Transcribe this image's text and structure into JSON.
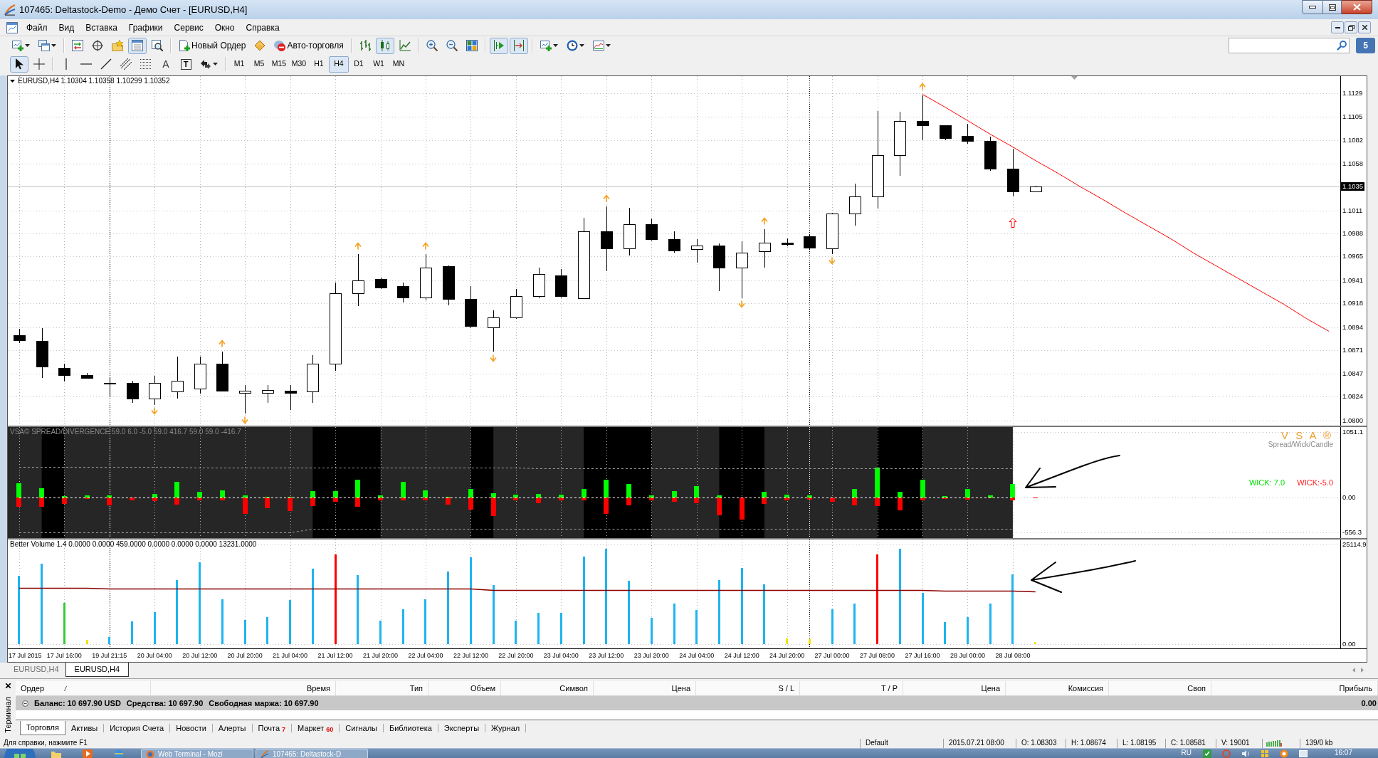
{
  "window": {
    "title": "107465: Deltastock-Demo - Демо Счет - [EURUSD,H4]"
  },
  "menu": {
    "items": [
      "Файл",
      "Вид",
      "Вставка",
      "Графики",
      "Сервис",
      "Окно",
      "Справка"
    ]
  },
  "toolbar_main": {
    "groups": [
      [
        {
          "kind": "dropdown",
          "pressed": false
        },
        {
          "kind": "dropdown",
          "pressed": false
        }
      ],
      [
        {
          "kind": "icon",
          "pressed": false
        },
        {
          "kind": "icon",
          "pressed": false
        },
        {
          "kind": "icon",
          "pressed": false
        },
        {
          "kind": "icon",
          "pressed": true
        },
        {
          "kind": "icon",
          "pressed": false
        }
      ],
      [
        {
          "kind": "labeled",
          "label": "Новый Ордер",
          "pressed": false
        },
        {
          "kind": "icon",
          "pressed": false
        },
        {
          "kind": "labeled",
          "label": "Авто-торговля",
          "pressed": false
        }
      ],
      [
        {
          "kind": "icon",
          "pressed": false
        },
        {
          "kind": "icon",
          "pressed": true
        },
        {
          "kind": "icon",
          "pressed": false
        }
      ],
      [
        {
          "kind": "icon",
          "pressed": false
        },
        {
          "kind": "icon",
          "pressed": false
        },
        {
          "kind": "icon",
          "pressed": false
        }
      ],
      [
        {
          "kind": "icon",
          "pressed": true
        },
        {
          "kind": "icon",
          "pressed": true
        }
      ],
      [
        {
          "kind": "dropdown",
          "pressed": false
        },
        {
          "kind": "dropdown",
          "pressed": false
        },
        {
          "kind": "dropdown",
          "pressed": false
        }
      ]
    ]
  },
  "search": {
    "badge": "5"
  },
  "toolbar_draw": {
    "groups": [
      [
        {
          "kind": "icon",
          "pressed": true
        },
        {
          "kind": "icon",
          "pressed": false
        }
      ],
      [
        {
          "kind": "icon",
          "pressed": false
        },
        {
          "kind": "icon",
          "pressed": false
        },
        {
          "kind": "icon",
          "pressed": false
        },
        {
          "kind": "icon",
          "pressed": false
        },
        {
          "kind": "icon",
          "pressed": false
        },
        {
          "kind": "glyph",
          "label": "A",
          "pressed": false
        },
        {
          "kind": "boxed-glyph",
          "label": "T",
          "pressed": false
        },
        {
          "kind": "dropdown",
          "pressed": false
        }
      ]
    ],
    "timeframes": [
      {
        "label": "M1",
        "selected": false
      },
      {
        "label": "M5",
        "selected": false
      },
      {
        "label": "M15",
        "selected": false
      },
      {
        "label": "M30",
        "selected": false
      },
      {
        "label": "H1",
        "selected": false
      },
      {
        "label": "H4",
        "selected": true
      },
      {
        "label": "D1",
        "selected": false
      },
      {
        "label": "W1",
        "selected": false
      },
      {
        "label": "MN",
        "selected": false
      }
    ]
  },
  "chart": {
    "chart_data": [
      {
        "type": "candlestick",
        "title": "EURUSD,H4 1.10304 1.10358 1.10299 1.10352",
        "categories": [
          null,
          null,
          null,
          null,
          null,
          null,
          null,
          null,
          null,
          null,
          null,
          null,
          null,
          null,
          null,
          null,
          null,
          null,
          null,
          null,
          null,
          null,
          null,
          null,
          null,
          null,
          null,
          null,
          null,
          null,
          null,
          null,
          null,
          null,
          null,
          null,
          null,
          null,
          null,
          null,
          null,
          null,
          null,
          null,
          null,
          null,
          null,
          null,
          null,
          null,
          null,
          null,
          null,
          null,
          null,
          null,
          null,
          null,
          null
        ],
        "ohlc": [
          [
            1.0886,
            1.0892,
            1.0878,
            1.0881
          ],
          [
            1.088,
            1.0893,
            1.0843,
            1.0854
          ],
          [
            1.0853,
            1.0857,
            1.0839,
            1.0846
          ],
          [
            1.0846,
            1.0848,
            1.0842,
            1.0843
          ],
          [
            1.0838,
            1.0843,
            1.0824,
            1.0837
          ],
          [
            1.0838,
            1.084,
            1.0818,
            1.0822
          ],
          [
            1.0822,
            1.0845,
            1.0816,
            1.0838
          ],
          [
            1.0829,
            1.0864,
            1.0822,
            1.084
          ],
          [
            1.0832,
            1.0864,
            1.0827,
            1.0857
          ],
          [
            1.0857,
            1.0869,
            1.0829,
            1.083
          ],
          [
            1.0828,
            1.0836,
            1.0807,
            1.083
          ],
          [
            1.0828,
            1.0836,
            1.0818,
            1.0831
          ],
          [
            1.083,
            1.0836,
            1.0811,
            1.0828
          ],
          [
            1.0829,
            1.0866,
            1.0818,
            1.0857
          ],
          [
            1.0857,
            1.0939,
            1.085,
            1.0928
          ],
          [
            1.0928,
            1.0967,
            1.0915,
            1.0941
          ],
          [
            1.0942,
            1.0944,
            1.0932,
            1.0934
          ],
          [
            1.0935,
            1.0939,
            1.0919,
            1.0924
          ],
          [
            1.0924,
            1.0967,
            1.0921,
            1.0954
          ],
          [
            1.0955,
            1.0956,
            1.0916,
            1.0922
          ],
          [
            1.0922,
            1.0935,
            1.0893,
            1.0895
          ],
          [
            1.0894,
            1.0911,
            1.0869,
            1.0904
          ],
          [
            1.0904,
            1.0932,
            1.0902,
            1.0925
          ],
          [
            1.0925,
            1.0954,
            1.0923,
            1.0947
          ],
          [
            1.0946,
            1.0952,
            1.0924,
            1.0925
          ],
          [
            1.0923,
            1.1004,
            1.0922,
            1.099
          ],
          [
            1.099,
            1.1015,
            1.095,
            1.0973
          ],
          [
            1.0973,
            1.1014,
            1.0966,
            1.0997
          ],
          [
            1.0997,
            1.1003,
            1.0981,
            1.0982
          ],
          [
            1.0982,
            1.099,
            1.0969,
            1.0971
          ],
          [
            1.0972,
            1.0982,
            1.0959,
            1.0976
          ],
          [
            1.0976,
            1.0978,
            1.093,
            1.0954
          ],
          [
            1.0954,
            1.098,
            1.0923,
            1.0969
          ],
          [
            1.097,
            1.0992,
            1.0954,
            1.0979
          ],
          [
            1.0979,
            1.0983,
            1.0975,
            1.0977
          ],
          [
            1.0985,
            1.0987,
            1.0972,
            1.0974
          ],
          [
            1.0973,
            1.1009,
            1.0967,
            1.1008
          ],
          [
            1.1008,
            1.1038,
            1.0996,
            1.1025
          ],
          [
            1.1025,
            1.1111,
            1.1013,
            1.1067
          ],
          [
            1.1067,
            1.111,
            1.1046,
            1.1101
          ],
          [
            1.1101,
            1.1127,
            1.1082,
            1.1097
          ],
          [
            1.1097,
            1.1097,
            1.1082,
            1.1084
          ],
          [
            1.1086,
            1.1098,
            1.1078,
            1.1081
          ],
          [
            1.1081,
            1.1085,
            1.1051,
            1.1053
          ],
          [
            1.1053,
            1.1073,
            1.1025,
            1.103
          ],
          [
            1.10304,
            1.10358,
            1.10299,
            1.10352
          ],
          null,
          null,
          null,
          null,
          null,
          null,
          null,
          null,
          null,
          null,
          null,
          null,
          null
        ],
        "series": [
          {
            "type": "scatter",
            "color": "#f7a01c",
            "values": [
              null,
              null,
              null,
              null,
              null,
              null,
              null,
              null,
              null,
              1.0877,
              null,
              null,
              null,
              null,
              null,
              1.0975,
              null,
              null,
              1.0975,
              null,
              null,
              null,
              null,
              null,
              null,
              null,
              1.1023,
              null,
              null,
              null,
              null,
              null,
              null,
              1.1,
              null,
              null,
              null,
              null,
              null,
              null,
              1.1135,
              null,
              null,
              null,
              null,
              null,
              null,
              null,
              null,
              null,
              null,
              null,
              null,
              null,
              null,
              null,
              null,
              null,
              null
            ]
          },
          {
            "type": "scatter",
            "color": "#f7a01c",
            "values": [
              null,
              null,
              null,
              null,
              null,
              null,
              1.081,
              null,
              null,
              null,
              1.0801,
              null,
              null,
              null,
              null,
              null,
              null,
              null,
              null,
              null,
              null,
              1.0863,
              null,
              null,
              null,
              null,
              null,
              null,
              null,
              null,
              null,
              null,
              1.0917,
              null,
              null,
              null,
              1.0961,
              null,
              null,
              null,
              null,
              null,
              null,
              null,
              null,
              null,
              null,
              null,
              null,
              null,
              null,
              null,
              null,
              null,
              null,
              null,
              null,
              null,
              null
            ]
          },
          {
            "type": "scatter",
            "color": "#ff0000",
            "values": [
              null,
              null,
              null,
              null,
              null,
              null,
              null,
              null,
              null,
              null,
              null,
              null,
              null,
              null,
              null,
              null,
              null,
              null,
              null,
              null,
              null,
              null,
              null,
              null,
              null,
              null,
              null,
              null,
              null,
              null,
              null,
              null,
              null,
              null,
              null,
              null,
              null,
              null,
              null,
              null,
              null,
              null,
              null,
              null,
              1.0999,
              null,
              null,
              null,
              null,
              null,
              null,
              null,
              null,
              null,
              null,
              null,
              null,
              null,
              null
            ]
          },
          {
            "type": "line",
            "color": "#ff0000",
            "values": [
              null,
              null,
              null,
              null,
              null,
              null,
              null,
              null,
              null,
              null,
              null,
              null,
              null,
              null,
              null,
              null,
              null,
              null,
              null,
              null,
              null,
              null,
              null,
              null,
              null,
              null,
              null,
              null,
              null,
              null,
              null,
              null,
              null,
              null,
              null,
              null,
              null,
              null,
              null,
              null,
              1.1128,
              1.1115,
              1.1102,
              1.1088,
              1.1075,
              1.1062,
              1.1049,
              1.1035,
              1.1022,
              1.1009,
              1.0996,
              1.0983,
              1.0969,
              1.0956,
              1.0943,
              1.093,
              1.0917,
              1.0903,
              1.089
            ]
          }
        ],
        "ylim": [
          1.0795,
          1.1146
        ],
        "yticks": [
          {
            "value": 1.1129,
            "label": "1.1129"
          },
          {
            "value": 1.1105,
            "label": "1.1105"
          },
          {
            "value": 1.1082,
            "label": "1.1082"
          },
          {
            "value": 1.1058,
            "label": "1.1058"
          },
          {
            "value": 1.1011,
            "label": "1.1011"
          },
          {
            "value": 1.0988,
            "label": "1.0988"
          },
          {
            "value": 1.0965,
            "label": "1.0965"
          },
          {
            "value": 1.0941,
            "label": "1.0941"
          },
          {
            "value": 1.0918,
            "label": "1.0918"
          },
          {
            "value": 1.0894,
            "label": "1.0894"
          },
          {
            "value": 1.0871,
            "label": "1.0871"
          },
          {
            "value": 1.0847,
            "label": "1.0847"
          },
          {
            "value": 1.0824,
            "label": "1.0824"
          },
          {
            "value": 1.08,
            "label": "1.0800"
          }
        ],
        "tick_labels": "y",
        "grid": true,
        "ref_lines": [
          {
            "axis": "y",
            "value": 1.10352,
            "label": "1.1035",
            "color": "#c0c0c0"
          }
        ]
      },
      {
        "type": "bar",
        "title": "VSA© SPREAD/DIVERGENCE 59.0 6.0 -5.0 59.0 416.7 59.0 59.0 -416.7",
        "categories": [
          null,
          null,
          null,
          null,
          null,
          null,
          null,
          null,
          null,
          null,
          null,
          null,
          null,
          null,
          null,
          null,
          null,
          null,
          null,
          null,
          null,
          null,
          null,
          null,
          null,
          null,
          null,
          null,
          null,
          null,
          null,
          null,
          null,
          null,
          null,
          null,
          null,
          null,
          null,
          null,
          null,
          null,
          null,
          null,
          null,
          null,
          null,
          null,
          null,
          null,
          null,
          null,
          null,
          null,
          null,
          null,
          null,
          null,
          null
        ],
        "stacked": true,
        "series": [
          {
            "color": "#00ff00",
            "values": [
              230,
              150,
              20,
              30,
              40,
              null,
              60,
              250,
              90,
              120,
              40,
              10,
              10,
              100,
              100,
              290,
              30,
              250,
              110,
              10,
              140,
              70,
              50,
              60,
              50,
              140,
              280,
              220,
              30,
              100,
              180,
              30,
              null,
              90,
              50,
              30,
              null,
              140,
              480,
              90,
              280,
              20,
              140,
              30,
              220,
              null,
              null,
              null,
              null,
              null,
              null,
              null,
              null,
              null,
              null,
              null,
              null,
              null,
              null
            ]
          },
          {
            "color": "#ff0000",
            "values": [
              -150,
              -150,
              -100,
              -20,
              -120,
              -50,
              -60,
              -110,
              -50,
              -40,
              -260,
              -170,
              -220,
              -140,
              -70,
              -150,
              -50,
              -40,
              -50,
              -110,
              -190,
              -300,
              -40,
              -90,
              -50,
              -40,
              -260,
              -120,
              -40,
              -70,
              -90,
              -280,
              -350,
              -100,
              -50,
              -30,
              -70,
              -120,
              -140,
              -210,
              -50,
              -20,
              -30,
              -10,
              -40,
              -10,
              null,
              null,
              null,
              null,
              null,
              null,
              null,
              null,
              null,
              null,
              null,
              null,
              null
            ]
          },
          {
            "type": "line",
            "color": "#a0a0a0",
            "line_style": "dashed",
            "values": [
              490,
              490,
              490,
              490,
              490,
              490,
              490,
              490,
              480,
              480,
              480,
              480,
              480,
              480,
              480,
              480,
              480,
              480,
              480,
              480,
              480,
              480,
              480,
              470,
              470,
              470,
              470,
              470,
              470,
              470,
              470,
              470,
              470,
              470,
              470,
              470,
              470,
              470,
              470,
              470,
              470,
              470,
              470,
              470,
              470,
              null,
              null,
              null,
              null,
              null,
              null,
              null,
              null,
              null,
              null,
              null,
              null,
              null,
              null
            ]
          },
          {
            "type": "line",
            "color": "#a0a0a0",
            "line_style": "dashed",
            "values": [
              -560,
              -560,
              -560,
              -560,
              -560,
              -560,
              -560,
              -560,
              -560,
              -560,
              -560,
              -560,
              -560,
              -500,
              -500,
              -500,
              -500,
              -500,
              -500,
              -500,
              -500,
              -500,
              -500,
              -500,
              -500,
              -500,
              -500,
              -500,
              -500,
              -500,
              -500,
              -500,
              -500,
              -500,
              -500,
              -500,
              -500,
              -500,
              -500,
              -500,
              -500,
              -500,
              -500,
              -500,
              -500,
              null,
              null,
              null,
              null,
              null,
              null,
              null,
              null,
              null,
              null,
              null,
              null,
              null,
              null
            ]
          },
          {
            "type": "line",
            "color": "#ffffff",
            "line_style": "dashed",
            "values": [
              0,
              0,
              0,
              0,
              0,
              0,
              0,
              0,
              0,
              0,
              0,
              0,
              0,
              0,
              0,
              0,
              0,
              0,
              0,
              0,
              0,
              0,
              0,
              0,
              0,
              0,
              0,
              0,
              0,
              0,
              0,
              0,
              0,
              0,
              0,
              0,
              0,
              0,
              0,
              0,
              0,
              0,
              0,
              0,
              0,
              null,
              null,
              null,
              null,
              null,
              null,
              null,
              null,
              null,
              null,
              null,
              null,
              null,
              null
            ]
          }
        ],
        "ylim": [
          -650,
          1130
        ],
        "yticks": [
          {
            "value": 1051.1,
            "label": "1051.1"
          },
          {
            "value": 0,
            "label": "0.00"
          },
          {
            "value": -556.3,
            "label": "-556.3"
          }
        ],
        "tick_labels": "y",
        "grid": true,
        "annotations": [
          "V S A ®",
          "Spread/Wick/Candle",
          "WICK: 7.0",
          "WICK:-5.0"
        ]
      },
      {
        "type": "bar",
        "title": "Better Volume 1.4 0.0000 0.0000 459.0000 0.0000 0.0000 0.0000 13231.0000",
        "categories": [
          "17 Jul 2015",
          null,
          "17 Jul 16:00",
          null,
          "19 Jul 21:15",
          null,
          "20 Jul 04:00",
          null,
          "20 Jul 12:00",
          null,
          "20 Jul 20:00",
          null,
          "21 Jul 04:00",
          null,
          "21 Jul 12:00",
          null,
          "21 Jul 20:00",
          null,
          "22 Jul 04:00",
          null,
          "22 Jul 12:00",
          null,
          "22 Jul 20:00",
          null,
          "23 Jul 04:00",
          null,
          "23 Jul 12:00",
          null,
          "23 Jul 20:00",
          null,
          "24 Jul 04:00",
          null,
          "24 Jul 12:00",
          null,
          "24 Jul 20:00",
          null,
          "27 Jul 00:00",
          null,
          "27 Jul 08:00",
          null,
          "27 Jul 16:00",
          null,
          "28 Jul 00:00",
          null,
          "28 Jul 08:00",
          null,
          null,
          null,
          null,
          null,
          null,
          null,
          null,
          null,
          null,
          null,
          null,
          null,
          null
        ],
        "series": [
          {
            "type": "bar",
            "colors": [
              "#1eb4f0",
              "#1eb4f0",
              "#32cd32",
              "#f2e200",
              "#1eb4f0",
              "#1eb4f0",
              "#1eb4f0",
              "#1eb4f0",
              "#1eb4f0",
              "#1eb4f0",
              "#1eb4f0",
              "#1eb4f0",
              "#1eb4f0",
              "#1eb4f0",
              "#ff0000",
              "#1eb4f0",
              "#1eb4f0",
              "#1eb4f0",
              "#1eb4f0",
              "#1eb4f0",
              "#1eb4f0",
              "#1eb4f0",
              "#1eb4f0",
              "#1eb4f0",
              "#1eb4f0",
              "#1eb4f0",
              "#1eb4f0",
              "#1eb4f0",
              "#1eb4f0",
              "#1eb4f0",
              "#1eb4f0",
              "#1eb4f0",
              "#1eb4f0",
              "#1eb4f0",
              "#f2e200",
              "#f2e200",
              "#1eb4f0",
              "#1eb4f0",
              "#ff0000",
              "#1eb4f0",
              "#1eb4f0",
              "#1eb4f0",
              "#1eb4f0",
              "#1eb4f0",
              "#1eb4f0",
              "#f2e200",
              null,
              null,
              null,
              null,
              null,
              null,
              null,
              null,
              null,
              null,
              null,
              null,
              null
            ],
            "values": [
              17100,
              20300,
              10400,
              1100,
              1700,
              5700,
              8000,
              16100,
              20500,
              11200,
              6100,
              6800,
              11000,
              19000,
              22600,
              17300,
              5900,
              8700,
              11200,
              18200,
              21800,
              14800,
              5900,
              7800,
              7800,
              22000,
              23900,
              15900,
              6600,
              10100,
              8500,
              16100,
              19200,
              15000,
              1500,
              1300,
              8700,
              10100,
              22600,
              23900,
              12900,
              5500,
              6800,
              10100,
              17500,
              500,
              null,
              null,
              null,
              null,
              null,
              null,
              null,
              null,
              null,
              null,
              null,
              null,
              null
            ]
          },
          {
            "type": "line",
            "color": "#8b0000",
            "values": [
              14200,
              14200,
              14200,
              14200,
              14000,
              14000,
              14000,
              14000,
              14000,
              14000,
              14000,
              14000,
              14000,
              14000,
              13900,
              13900,
              13900,
              13900,
              13900,
              13900,
              13900,
              13600,
              13600,
              13600,
              13600,
              13600,
              13600,
              13600,
              13600,
              13600,
              13600,
              13600,
              13600,
              13600,
              13600,
              13600,
              13600,
              13600,
              13600,
              13600,
              13600,
              13400,
              13400,
              13400,
              13400,
              13200,
              null,
              null,
              null,
              null,
              null,
              null,
              null,
              null,
              null,
              null,
              null,
              null,
              null
            ]
          }
        ],
        "ylim": [
          -1095.95,
          26300
        ],
        "yticks": [
          {
            "value": 25114.9,
            "label": "25114.9"
          },
          {
            "value": 0,
            "label": "0.00"
          }
        ],
        "grid": true
      }
    ]
  },
  "chart_tabs": [
    {
      "label": "EURUSD,H4",
      "selected": false
    },
    {
      "label": "EURUSD,H4",
      "selected": true
    }
  ],
  "terminal": {
    "title": "Терминал",
    "columns": [
      {
        "label": "Ордер",
        "sorted": true
      },
      {
        "label": "Время",
        "sorted": false
      },
      {
        "label": "Тип",
        "sorted": false
      },
      {
        "label": "Объем",
        "sorted": false
      },
      {
        "label": "Символ",
        "sorted": false
      },
      {
        "label": "Цена",
        "sorted": false
      },
      {
        "label": "S / L",
        "sorted": false
      },
      {
        "label": "T / P",
        "sorted": false
      },
      {
        "label": "Цена",
        "sorted": false
      },
      {
        "label": "Комиссия",
        "sorted": false
      },
      {
        "label": "Своп",
        "sorted": false
      },
      {
        "label": "Прибыль",
        "sorted": false
      }
    ],
    "balance": [
      "Баланс: 10 697.90 USD",
      "Средства: 10 697.90",
      "Свободная маржа: 10 697.90"
    ],
    "profit": "0.00",
    "tabs": [
      {
        "label": "Торговля",
        "selected": true
      },
      {
        "label": "Активы",
        "selected": false
      },
      {
        "label": "История Счета",
        "selected": false
      },
      {
        "label": "Новости",
        "selected": false
      },
      {
        "label": "Алерты",
        "selected": false
      },
      {
        "label": "Почта",
        "badge": "7",
        "selected": false
      },
      {
        "label": "Маркет",
        "badge": "60",
        "selected": false
      },
      {
        "label": "Сигналы",
        "selected": false
      },
      {
        "label": "Библиотека",
        "selected": false
      },
      {
        "label": "Эксперты",
        "selected": false
      },
      {
        "label": "Журнал",
        "selected": false
      }
    ]
  },
  "status_bar": {
    "help": "Для справки, нажмите F1",
    "cells": [
      "Default",
      "2015.07.21 08:00",
      "O: 1.08303",
      "H: 1.08674",
      "L: 1.08195",
      "C: 1.08581",
      "V: 19001",
      "139/0 kb"
    ]
  },
  "taskbar": {
    "tasks": [
      "Web Terminal - Mozi",
      "107465: Deltastock-D"
    ],
    "language": "RU",
    "clock": "16:07"
  }
}
